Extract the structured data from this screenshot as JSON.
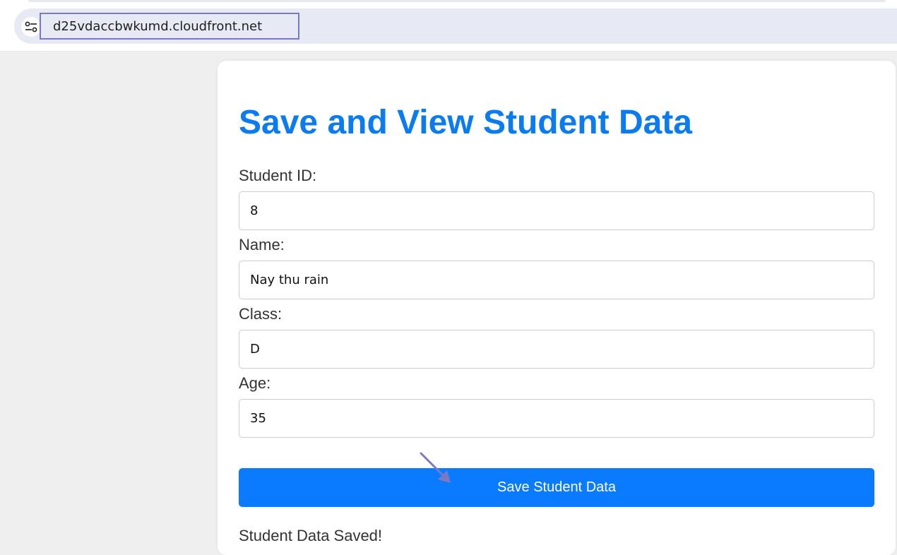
{
  "browser": {
    "url": "d25vdaccbwkumd.cloudfront.net"
  },
  "page": {
    "title": "Save and View Student Data"
  },
  "form": {
    "student_id": {
      "label": "Student ID:",
      "value": "8"
    },
    "name": {
      "label": "Name:",
      "value": "Nay thu rain"
    },
    "class": {
      "label": "Class:",
      "value": "D"
    },
    "age": {
      "label": "Age:",
      "value": "35"
    },
    "save_label": "Save Student Data"
  },
  "status": {
    "message": "Student Data Saved!"
  },
  "colors": {
    "accent": "#0a7bff",
    "title": "#0a7bf0",
    "highlight_box": "#7b79c4"
  },
  "icons": {
    "site_info": "tune-icon",
    "pointer": "arrow-annotation-icon"
  }
}
